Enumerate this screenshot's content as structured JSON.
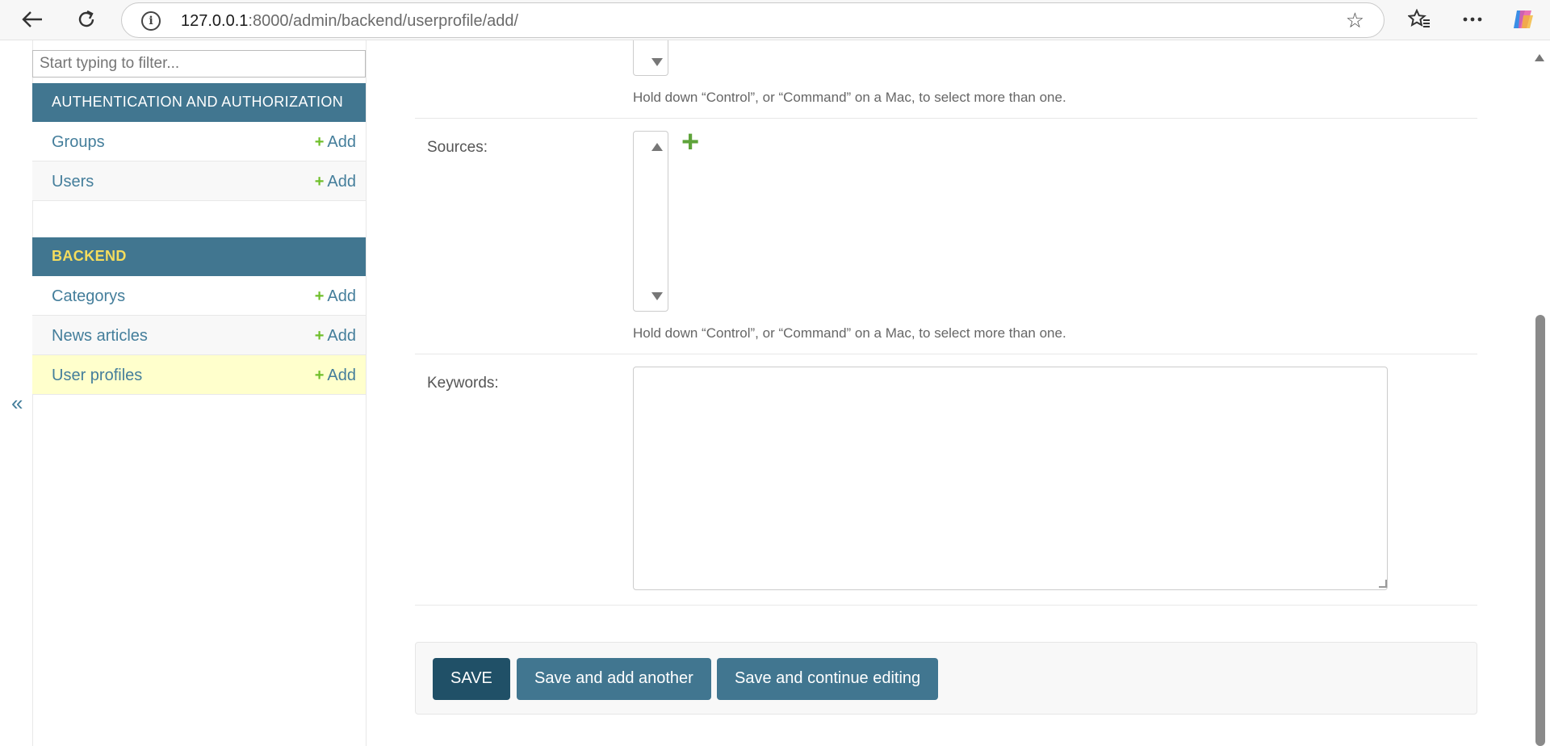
{
  "browser": {
    "url_host": "127.0.0.1",
    "url_rest": ":8000/admin/backend/userprofile/add/"
  },
  "sidebar": {
    "filter_placeholder": "Start typing to filter...",
    "modules": [
      {
        "caption": "AUTHENTICATION AND AUTHORIZATION",
        "models": [
          {
            "name": "Groups",
            "add_label": "Add"
          },
          {
            "name": "Users",
            "add_label": "Add"
          }
        ]
      },
      {
        "caption": "BACKEND",
        "models": [
          {
            "name": "Categorys",
            "add_label": "Add"
          },
          {
            "name": "News articles",
            "add_label": "Add"
          },
          {
            "name": "User profiles",
            "add_label": "Add",
            "current": true
          }
        ]
      }
    ],
    "collapse_label": "«"
  },
  "form": {
    "top_help": "Hold down “Control”, or “Command” on a Mac, to select more than one.",
    "sources": {
      "label": "Sources:",
      "help": "Hold down “Control”, or “Command” on a Mac, to select more than one."
    },
    "keywords": {
      "label": "Keywords:",
      "value": ""
    }
  },
  "submit": {
    "save": "SAVE",
    "save_add_another": "Save and add another",
    "save_continue": "Save and continue editing"
  },
  "colors": {
    "module_header": "#417690",
    "current_row": "#ffffcc",
    "add_plus": "#70bf2b",
    "link": "#447e9b"
  }
}
